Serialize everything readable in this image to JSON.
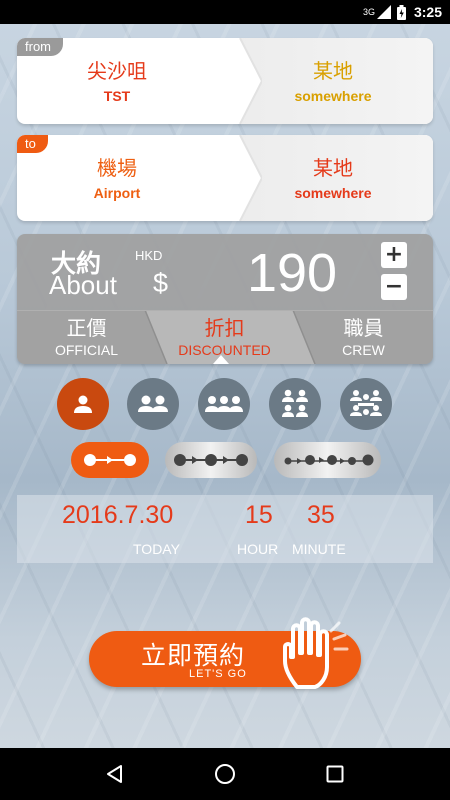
{
  "status_bar": {
    "network": "3G",
    "time": "3:25",
    "icons": [
      "signal-icon",
      "battery-icon"
    ]
  },
  "from_card": {
    "tag": "from",
    "origin_zh": "尖沙咀",
    "origin_en": "TST",
    "dest_zh": "某地",
    "dest_en": "somewhere"
  },
  "to_card": {
    "tag": "to",
    "origin_zh": "機場",
    "origin_en": "Airport",
    "dest_zh": "某地",
    "dest_en": "somewhere"
  },
  "fare": {
    "about_zh": "大約",
    "about_en": "About",
    "currency": "HKD",
    "symbol": "$",
    "price": "190",
    "plus": "+",
    "minus": "−",
    "tabs": [
      {
        "zh": "正價",
        "en": "OFFICIAL",
        "active": false
      },
      {
        "zh": "折扣",
        "en": "DISCOUNTED",
        "active": true
      },
      {
        "zh": "職員",
        "en": "CREW",
        "active": false
      }
    ]
  },
  "passengers": {
    "options": [
      1,
      2,
      3,
      4,
      6
    ],
    "selected": 1
  },
  "stops": {
    "options": [
      1,
      2,
      4
    ],
    "selected": 1
  },
  "datetime": {
    "date": "2016.7.30",
    "hour": "15",
    "minute": "35",
    "date_label": "TODAY",
    "hour_label": "HOUR",
    "minute_label": "MINUTE"
  },
  "go_button": {
    "zh": "立即預約",
    "en": "LET'S GO"
  },
  "colors": {
    "accent": "#ef5b12",
    "red_text": "#e53a1a",
    "gold_text": "#d9a000",
    "pax_inactive": "#6b7a86"
  },
  "nav": [
    "back-icon",
    "home-icon",
    "recents-icon"
  ]
}
